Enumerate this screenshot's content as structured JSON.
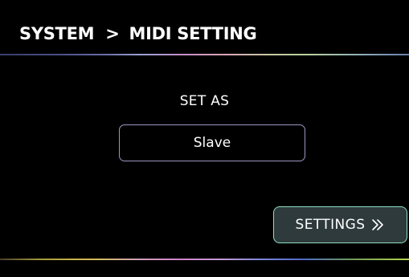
{
  "header": {
    "section": "SYSTEM",
    "separator": ">",
    "page": "MIDI SETTING"
  },
  "main": {
    "set_as_label": "SET AS",
    "mode_value": "Slave"
  },
  "footer": {
    "settings_label": "SETTINGS",
    "settings_icon": "double-chevron-right-icon"
  },
  "colors": {
    "background": "#000000",
    "select_border": "#9a98c4",
    "settings_border": "#8fe0c2",
    "settings_fill": "#2e3a3c"
  }
}
